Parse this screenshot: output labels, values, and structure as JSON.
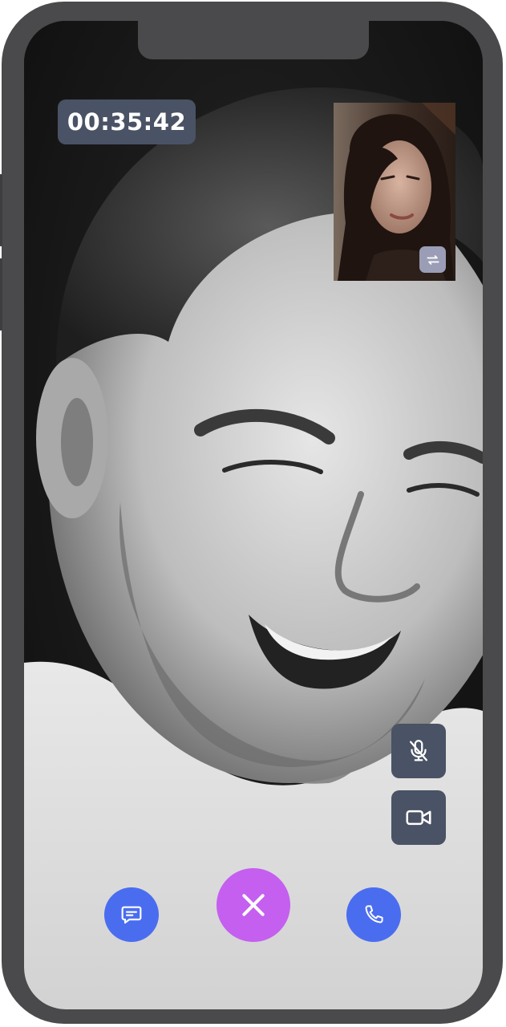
{
  "call": {
    "duration": "00:35:42"
  },
  "colors": {
    "control_background": "#4a5265",
    "primary_blue": "#4a6df0",
    "end_call_purple": "#c45ff0",
    "switch_camera_background": "#9a9db5"
  },
  "icons": {
    "switch_camera": "switch-camera-icon",
    "mute_mic": "mic-off-icon",
    "video": "video-camera-icon",
    "chat": "chat-bubble-icon",
    "end_call": "close-icon",
    "phone": "phone-icon"
  }
}
